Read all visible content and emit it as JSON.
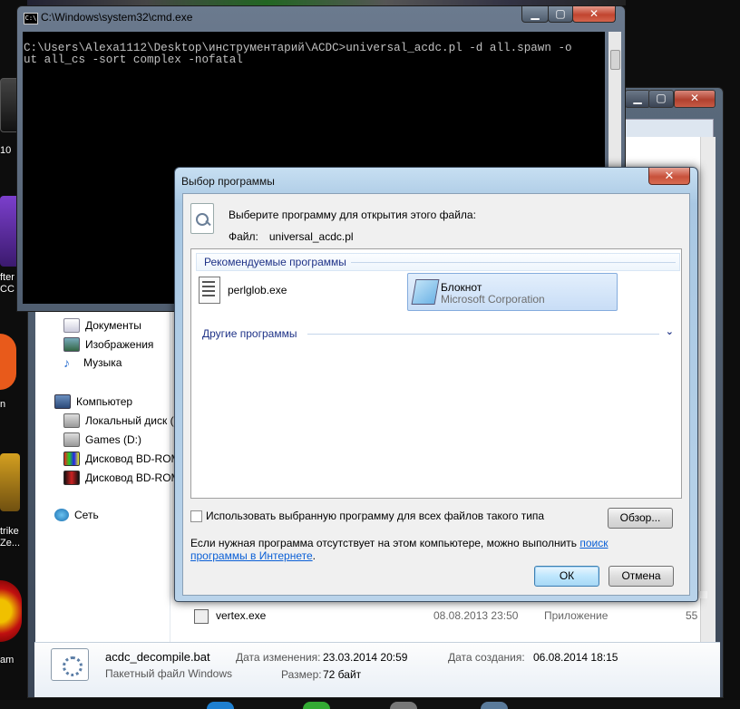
{
  "desktop": {
    "labels": [
      "10",
      "fter\nCC",
      "n",
      "trike\nZe...",
      "am"
    ]
  },
  "cmd": {
    "title": "C:\\Windows\\system32\\cmd.exe",
    "icon_text": "C:\\",
    "console_text": "C:\\Users\\Alexa1112\\Desktop\\инструментарий\\ACDC>universal_acdc.pl -d all.spawn -o\nut all_cs -sort complex -nofatal",
    "buttons": {
      "minimize": "▁",
      "maximize": "▢",
      "close": "✕"
    }
  },
  "explorer": {
    "buttons": {
      "minimize": "▁",
      "maximize": "▢",
      "close": "✕"
    },
    "nav": [
      {
        "label": "Документы",
        "icon": "documents-icon"
      },
      {
        "label": "Изображения",
        "icon": "pictures-icon"
      },
      {
        "label": "Музыка",
        "icon": "music-icon"
      },
      {
        "label": "Компьютер",
        "icon": "computer-icon"
      },
      {
        "label": "Локальный диск (C",
        "icon": "drive-icon"
      },
      {
        "label": "Games (D:)",
        "icon": "drive-icon"
      },
      {
        "label": "Дисковод BD-ROM",
        "icon": "disc-icon"
      },
      {
        "label": "Дисковод BD-ROM",
        "icon": "disc-icon"
      },
      {
        "label": "Сеть",
        "icon": "network-icon"
      }
    ],
    "file_row": {
      "name": "vertex.exe",
      "date": "08.08.2013 23:50",
      "type": "Приложение",
      "size": "55"
    },
    "details": {
      "file_name": "acdc_decompile.bat",
      "file_type": "Пакетный файл Windows",
      "modified_label": "Дата изменения:",
      "modified_value": "23.03.2014 20:59",
      "created_label": "Дата создания:",
      "created_value": "06.08.2014 18:15",
      "size_label": "Размер:",
      "size_value": "72 байт"
    }
  },
  "dialog": {
    "title": "Выбор программы",
    "close": "✕",
    "prompt": "Выберите программу для открытия этого файла:",
    "file_label": "Файл:",
    "file_name": "universal_acdc.pl",
    "recommended_header": "Рекомендуемые программы",
    "programs": [
      {
        "name": "perlglob.exe",
        "publisher": ""
      },
      {
        "name": "Блокнот",
        "publisher": "Microsoft Corporation"
      }
    ],
    "other_header": "Другие программы",
    "checkbox_label": "Использовать выбранную программу для всех файлов такого типа",
    "checkbox_checked": false,
    "browse": "Обзор...",
    "hint_text": "Если нужная программа отсутствует на этом компьютере, можно выполнить ",
    "hint_link": "поиск программы в Интернете",
    "hint_end": ".",
    "ok": "ОК",
    "cancel": "Отмена"
  }
}
